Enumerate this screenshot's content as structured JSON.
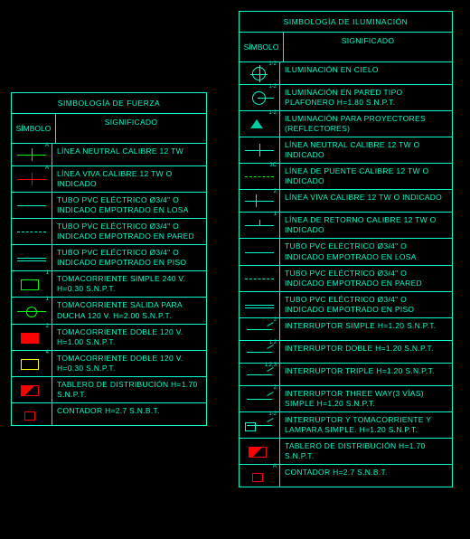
{
  "fuerza": {
    "title": "SIMBOLOGÍA DE FUERZA",
    "hdr_sym": "SÍMBOLO",
    "hdr_sig": "SIGNIFICADO",
    "rows": [
      {
        "sym": "neutral",
        "tag": "A",
        "sig": "LÍNEA NEUTRAL CALIBRE 12 TW"
      },
      {
        "sym": "viva",
        "tag": "A",
        "sig": "LÍNEA VIVA CALIBRE 12 TW O INDICADO"
      },
      {
        "sym": "tubo-losa",
        "tag": "",
        "sig": "TUBO PVC ELÉCTRICO Ø3/4\" O INDICADO EMPOTRADO EN LOSA"
      },
      {
        "sym": "tubo-pared",
        "tag": "",
        "sig": "TUBO PVC ELÉCTRICO Ø3/4\" O INDICADO EMPOTRADO EN PARED"
      },
      {
        "sym": "tubo-piso",
        "tag": "",
        "sig": "TUBO PVC ELÉCTRICO Ø3/4\" O INDICADO EMPOTRADO EN PISO"
      },
      {
        "sym": "toma1",
        "tag": "1",
        "sig": "TOMACORRIENTE SIMPLE 240 V. H=0.30 S.N.P.T."
      },
      {
        "sym": "toma-ducha",
        "tag": "1",
        "sig": "TOMACORRIENTE SALIDA PARA DUCHA 120 V. H=2.00 S.N.P.T."
      },
      {
        "sym": "toma-doble1",
        "tag": "2",
        "sig": "TOMACORRIENTE DOBLE 120 V. H=1.00  S.N.P.T."
      },
      {
        "sym": "toma-doble2",
        "tag": "4",
        "sig": "TOMACORRIENTE DOBLE 120 V. H=0.30 S.N.P.T."
      },
      {
        "sym": "tablero",
        "tag": "",
        "sig": "TABLERO DE DISTRIBUCIÓN H=1.70 S.N.P.T."
      },
      {
        "sym": "contador",
        "tag": "",
        "sig": "CONTADOR H=2.7 S.N.B.T."
      }
    ]
  },
  "ilum": {
    "title": "SIMBOLOGÍA DE ILUMINACIÓN",
    "hdr_sym": "SÍMBOLO",
    "hdr_sig": "SIGNIFICADO",
    "rows": [
      {
        "sym": "cielo",
        "tag": "1-2",
        "sig": "ILUMINACIÓN EN CIELO"
      },
      {
        "sym": "pared",
        "tag": "1-2",
        "sig": "ILUMINACIÓN EN PARED TIPO PLAFONERO H=1.80 S.N.P.T."
      },
      {
        "sym": "proyector",
        "tag": "1-2",
        "sig": "ILUMINACIÓN PARA PROYECTORES (REFLECTORES)"
      },
      {
        "sym": "neutral-c",
        "tag": "",
        "sig": "LÍNEA NEUTRAL CALIBRE 12 TW O INDICADO"
      },
      {
        "sym": "puente",
        "tag": "3C",
        "sig": "LÍNEA DE PUENTE CALIBRE 12 TW O INDICADO"
      },
      {
        "sym": "viva-c",
        "tag": "2",
        "sig": "LÍNEA VIVA CALIBRE 12 TW O INDICADO"
      },
      {
        "sym": "retorno",
        "tag": "1",
        "sig": "LÍNEA DE RETORNO CALIBRE 12 TW O INDICADO"
      },
      {
        "sym": "tubo-losa",
        "tag": "",
        "sig": "TUBO PVC ELÉCTRICO Ø3/4\" O INDICADO EMPOTRADO EN LOSA"
      },
      {
        "sym": "tubo-pared",
        "tag": "",
        "sig": "TUBO PVC ELÉCTRICO Ø3/4\" O INDICADO EMPOTRADO EN PARED"
      },
      {
        "sym": "tubo-piso",
        "tag": "",
        "sig": "TUBO PVC ELÉCTRICO Ø3/4\" O INDICADO EMPOTRADO EN PISO"
      },
      {
        "sym": "sw1",
        "tag": "2",
        "sig": "INTERRUPTOR SIMPLE H=1.20 S.N.P.T."
      },
      {
        "sym": "sw2",
        "tag": "1,2",
        "sig": "INTERRUPTOR DOBLE H=1.20 S.N.P.T."
      },
      {
        "sym": "sw3",
        "tag": "1,2,3",
        "sig": "INTERRUPTOR TRIPLE H=1.20 S.N.P.T."
      },
      {
        "sym": "sw3w",
        "tag": "2",
        "sig": "INTERRUPTOR THREE WAY(3 VÍAS) SIMPLE H=1.20 S.N.P.T."
      },
      {
        "sym": "sw-toma",
        "tag": "1-2",
        "sig": "INTERRUPTOR Y TOMACORRIENTE Y LAMPARA SIMPLE. H=1.20 S.N.P.T."
      },
      {
        "sym": "tablero",
        "tag": "",
        "sig": "TABLERO DE DISTRIBUCIÓN H=1.70 S.N.P.T."
      },
      {
        "sym": "contador",
        "tag": "A",
        "sig": "CONTADOR H=2.7 S.N.B.T."
      }
    ]
  }
}
